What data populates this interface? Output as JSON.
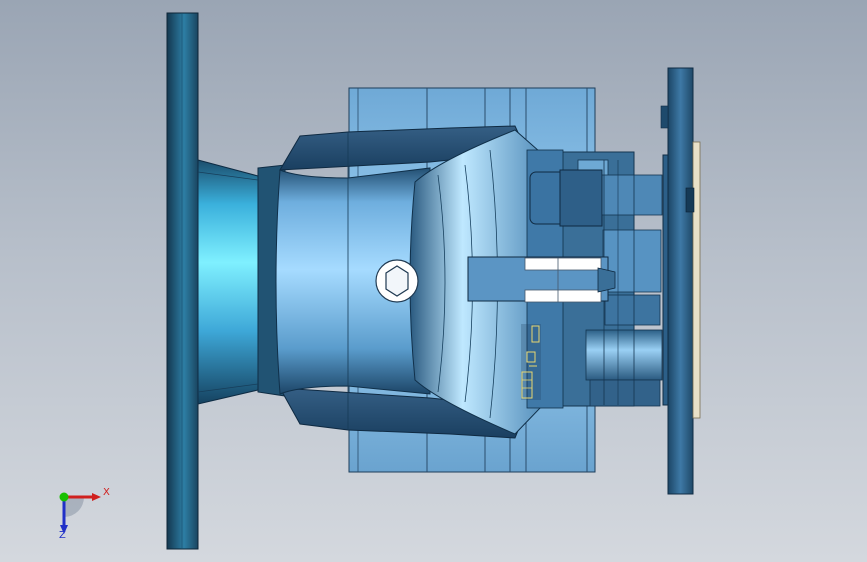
{
  "viewport": {
    "background_top": "#9aa5b4",
    "background_bottom": "#d4d8de"
  },
  "triad": {
    "x_label": "X",
    "z_label": "Z",
    "x_color": "#d0201e",
    "y_color": "#18c000",
    "z_color": "#2030c8"
  },
  "model": {
    "palette": {
      "flange_dark": "#1a4560",
      "flange_mid": "#2d7ea4",
      "body_light": "#86c4ec",
      "body_mid": "#4f8fbf",
      "body_dark": "#1f4a6c",
      "cone_highlight": "#78ecff"
    },
    "icons": [
      "hex-socket-screw-icon"
    ]
  }
}
